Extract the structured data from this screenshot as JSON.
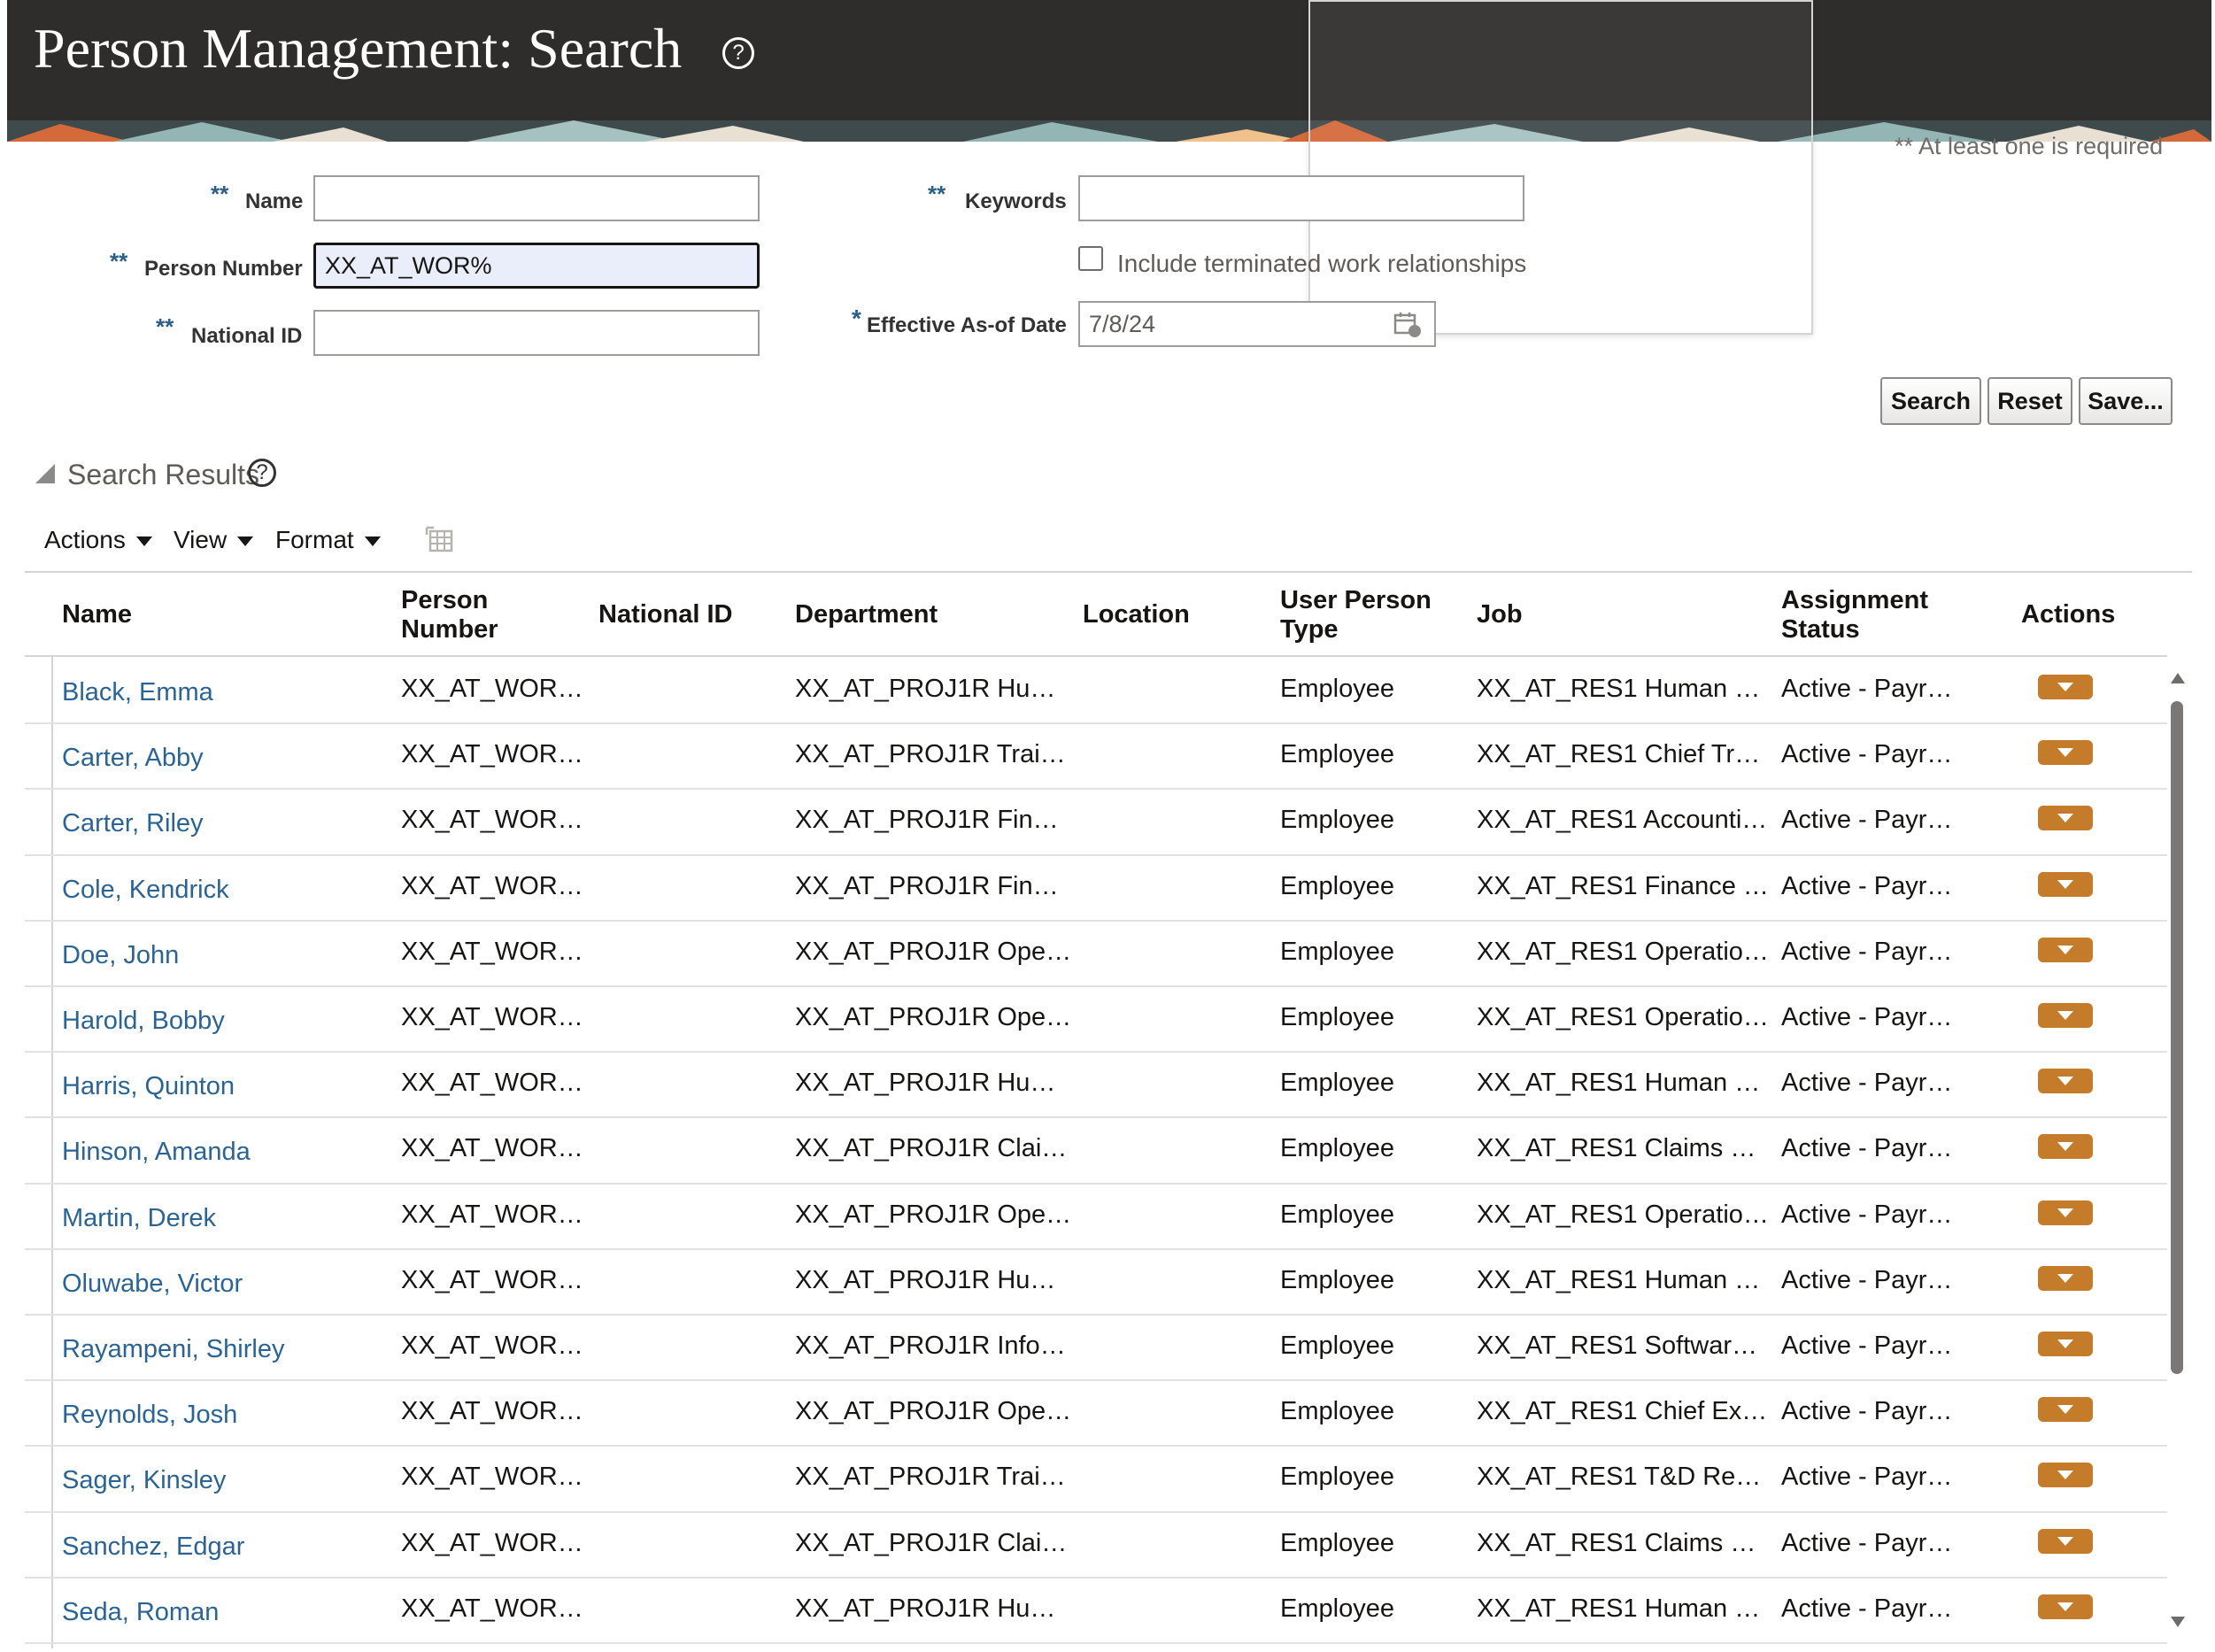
{
  "header": {
    "title": "Person Management: Search",
    "help_glyph": "?"
  },
  "form": {
    "required_note": "** At least one is required",
    "req_marker": "**",
    "date_req_marker": "*",
    "name": {
      "label": "Name",
      "value": ""
    },
    "person_number": {
      "label": "Person Number",
      "value": "XX_AT_WOR%"
    },
    "national_id": {
      "label": "National ID",
      "value": ""
    },
    "keywords": {
      "label": "Keywords",
      "value": ""
    },
    "include_terminated": {
      "label": "Include terminated work relationships",
      "checked": false
    },
    "effective_date": {
      "label": "Effective As-of Date",
      "value": "7/8/24"
    }
  },
  "buttons": {
    "search": "Search",
    "reset": "Reset",
    "save": "Save..."
  },
  "results": {
    "title": "Search Results",
    "help_glyph": "?",
    "menus": {
      "actions": "Actions",
      "view": "View",
      "format": "Format"
    },
    "columns": {
      "name": "Name",
      "person_number": "Person Number",
      "national_id": "National ID",
      "department": "Department",
      "location": "Location",
      "user_person_type": "User Person Type",
      "job": "Job",
      "assignment_status": "Assignment Status",
      "actions": "Actions"
    },
    "rows": [
      {
        "name": "Black, Emma",
        "person_number": "XX_AT_WOR…",
        "national_id": "",
        "department": "XX_AT_PROJ1R Hu…",
        "location": "",
        "type": "Employee",
        "job": "XX_AT_RES1 Human …",
        "status": "Active - Payr…"
      },
      {
        "name": "Carter, Abby",
        "person_number": "XX_AT_WOR…",
        "national_id": "",
        "department": "XX_AT_PROJ1R Trai…",
        "location": "",
        "type": "Employee",
        "job": "XX_AT_RES1 Chief Tr…",
        "status": "Active - Payr…"
      },
      {
        "name": "Carter, Riley",
        "person_number": "XX_AT_WOR…",
        "national_id": "",
        "department": "XX_AT_PROJ1R Fin…",
        "location": "",
        "type": "Employee",
        "job": "XX_AT_RES1 Accounti…",
        "status": "Active - Payr…"
      },
      {
        "name": "Cole, Kendrick",
        "person_number": "XX_AT_WOR…",
        "national_id": "",
        "department": "XX_AT_PROJ1R Fin…",
        "location": "",
        "type": "Employee",
        "job": "XX_AT_RES1 Finance …",
        "status": "Active - Payr…"
      },
      {
        "name": "Doe, John",
        "person_number": "XX_AT_WOR…",
        "national_id": "",
        "department": "XX_AT_PROJ1R Ope…",
        "location": "",
        "type": "Employee",
        "job": "XX_AT_RES1 Operatio…",
        "status": "Active - Payr…"
      },
      {
        "name": "Harold, Bobby",
        "person_number": "XX_AT_WOR…",
        "national_id": "",
        "department": "XX_AT_PROJ1R Ope…",
        "location": "",
        "type": "Employee",
        "job": "XX_AT_RES1 Operatio…",
        "status": "Active - Payr…"
      },
      {
        "name": "Harris, Quinton",
        "person_number": "XX_AT_WOR…",
        "national_id": "",
        "department": "XX_AT_PROJ1R Hu…",
        "location": "",
        "type": "Employee",
        "job": "XX_AT_RES1 Human …",
        "status": "Active - Payr…"
      },
      {
        "name": "Hinson, Amanda",
        "person_number": "XX_AT_WOR…",
        "national_id": "",
        "department": "XX_AT_PROJ1R Clai…",
        "location": "",
        "type": "Employee",
        "job": "XX_AT_RES1 Claims …",
        "status": "Active - Payr…"
      },
      {
        "name": "Martin, Derek",
        "person_number": "XX_AT_WOR…",
        "national_id": "",
        "department": "XX_AT_PROJ1R Ope…",
        "location": "",
        "type": "Employee",
        "job": "XX_AT_RES1 Operatio…",
        "status": "Active - Payr…"
      },
      {
        "name": "Oluwabe, Victor",
        "person_number": "XX_AT_WOR…",
        "national_id": "",
        "department": "XX_AT_PROJ1R Hu…",
        "location": "",
        "type": "Employee",
        "job": "XX_AT_RES1 Human …",
        "status": "Active - Payr…"
      },
      {
        "name": "Rayampeni, Shirley",
        "person_number": "XX_AT_WOR…",
        "national_id": "",
        "department": "XX_AT_PROJ1R Info…",
        "location": "",
        "type": "Employee",
        "job": "XX_AT_RES1 Softwar…",
        "status": "Active - Payr…"
      },
      {
        "name": "Reynolds, Josh",
        "person_number": "XX_AT_WOR…",
        "national_id": "",
        "department": "XX_AT_PROJ1R Ope…",
        "location": "",
        "type": "Employee",
        "job": "XX_AT_RES1 Chief Ex…",
        "status": "Active - Payr…"
      },
      {
        "name": "Sager, Kinsley",
        "person_number": "XX_AT_WOR…",
        "national_id": "",
        "department": "XX_AT_PROJ1R Trai…",
        "location": "",
        "type": "Employee",
        "job": "XX_AT_RES1 T&D Re…",
        "status": "Active - Payr…"
      },
      {
        "name": "Sanchez, Edgar",
        "person_number": "XX_AT_WOR…",
        "national_id": "",
        "department": "XX_AT_PROJ1R Clai…",
        "location": "",
        "type": "Employee",
        "job": "XX_AT_RES1 Claims …",
        "status": "Active - Payr…"
      },
      {
        "name": "Seda, Roman",
        "person_number": "XX_AT_WOR…",
        "national_id": "",
        "department": "XX_AT_PROJ1R Hu…",
        "location": "",
        "type": "Employee",
        "job": "XX_AT_RES1 Human …",
        "status": "Active - Payr…"
      }
    ]
  },
  "icons": {
    "calendar": "calendar-icon",
    "detach": "detach-table-icon",
    "row_action": "chevron-down-icon"
  },
  "colors": {
    "header_bg": "#2f2d2b",
    "link": "#2a6496",
    "required_marker": "#2b5f8a",
    "action_button": "#c47b2a",
    "focused_field_bg": "#eaeefb"
  }
}
